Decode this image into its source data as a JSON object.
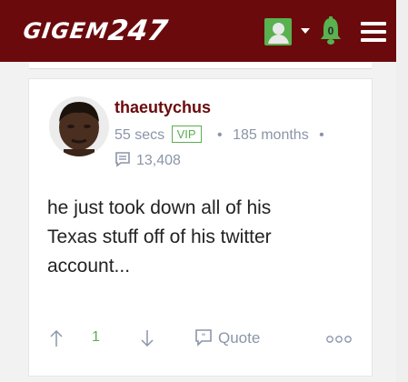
{
  "header": {
    "logo_text": "GIGEM",
    "logo_number": "247",
    "notification_count": "0",
    "colors": {
      "background": "#6b0a0c",
      "accent_green": "#59b14f"
    }
  },
  "post": {
    "username": "thaeutychus",
    "time_ago": "55 secs",
    "badge": "VIP",
    "member_duration": "185 months",
    "post_count": "13,408",
    "body_lines": [
      "he just took down all of his",
      "Texas stuff off of his twitter",
      "account..."
    ],
    "vote_count": "1",
    "quote_label": "Quote"
  },
  "icons": {
    "upvote": "arrow-up-icon",
    "downvote": "arrow-down-icon",
    "quote": "quote-bubble-icon",
    "more": "more-options-icon",
    "posts": "comment-icon",
    "bell": "bell-icon",
    "menu": "hamburger-icon"
  }
}
